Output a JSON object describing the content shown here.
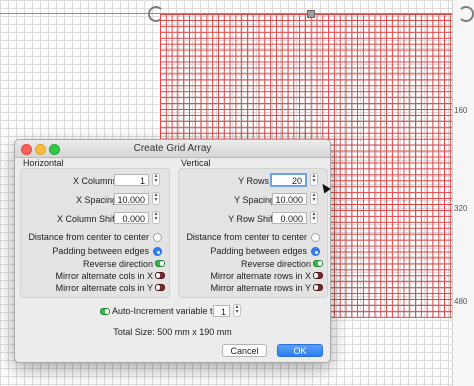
{
  "canvas": {
    "ruler_labels": [
      "160",
      "320",
      "480"
    ],
    "grid_color": "#e14545"
  },
  "dialog": {
    "title": "Create Grid Array",
    "horizontal": {
      "section_label": "Horizontal",
      "x_columns_label": "X Columns",
      "x_columns_value": "1",
      "x_spacing_label": "X Spacing",
      "x_spacing_value": "10.000",
      "x_shift_label": "X Column Shift",
      "x_shift_value": "0.000",
      "center_label": "Distance from center to center",
      "padding_label": "Padding between edges",
      "reverse_label": "Reverse direction",
      "mirror_x_label": "Mirror alternate cols in X",
      "mirror_y_label": "Mirror alternate cols in Y"
    },
    "vertical": {
      "section_label": "Vertical",
      "y_rows_label": "Y Rows",
      "y_rows_value": "20",
      "y_spacing_label": "Y Spacing",
      "y_spacing_value": "10.000",
      "y_shift_label": "Y Row Shift",
      "y_shift_value": "0.000",
      "center_label": "Distance from center to center",
      "padding_label": "Padding between edges",
      "reverse_label": "Reverse direction",
      "mirror_x_label": "Mirror alternate rows in X",
      "mirror_y_label": "Mirror alternate rows in Y"
    },
    "auto_increment_label": "Auto-Increment variable text",
    "auto_increment_value": "1",
    "total_size": "Total Size: 500 mm x 190 mm",
    "cancel_label": "Cancel",
    "ok_label": "OK",
    "accent_color": "#2f7cf6"
  }
}
